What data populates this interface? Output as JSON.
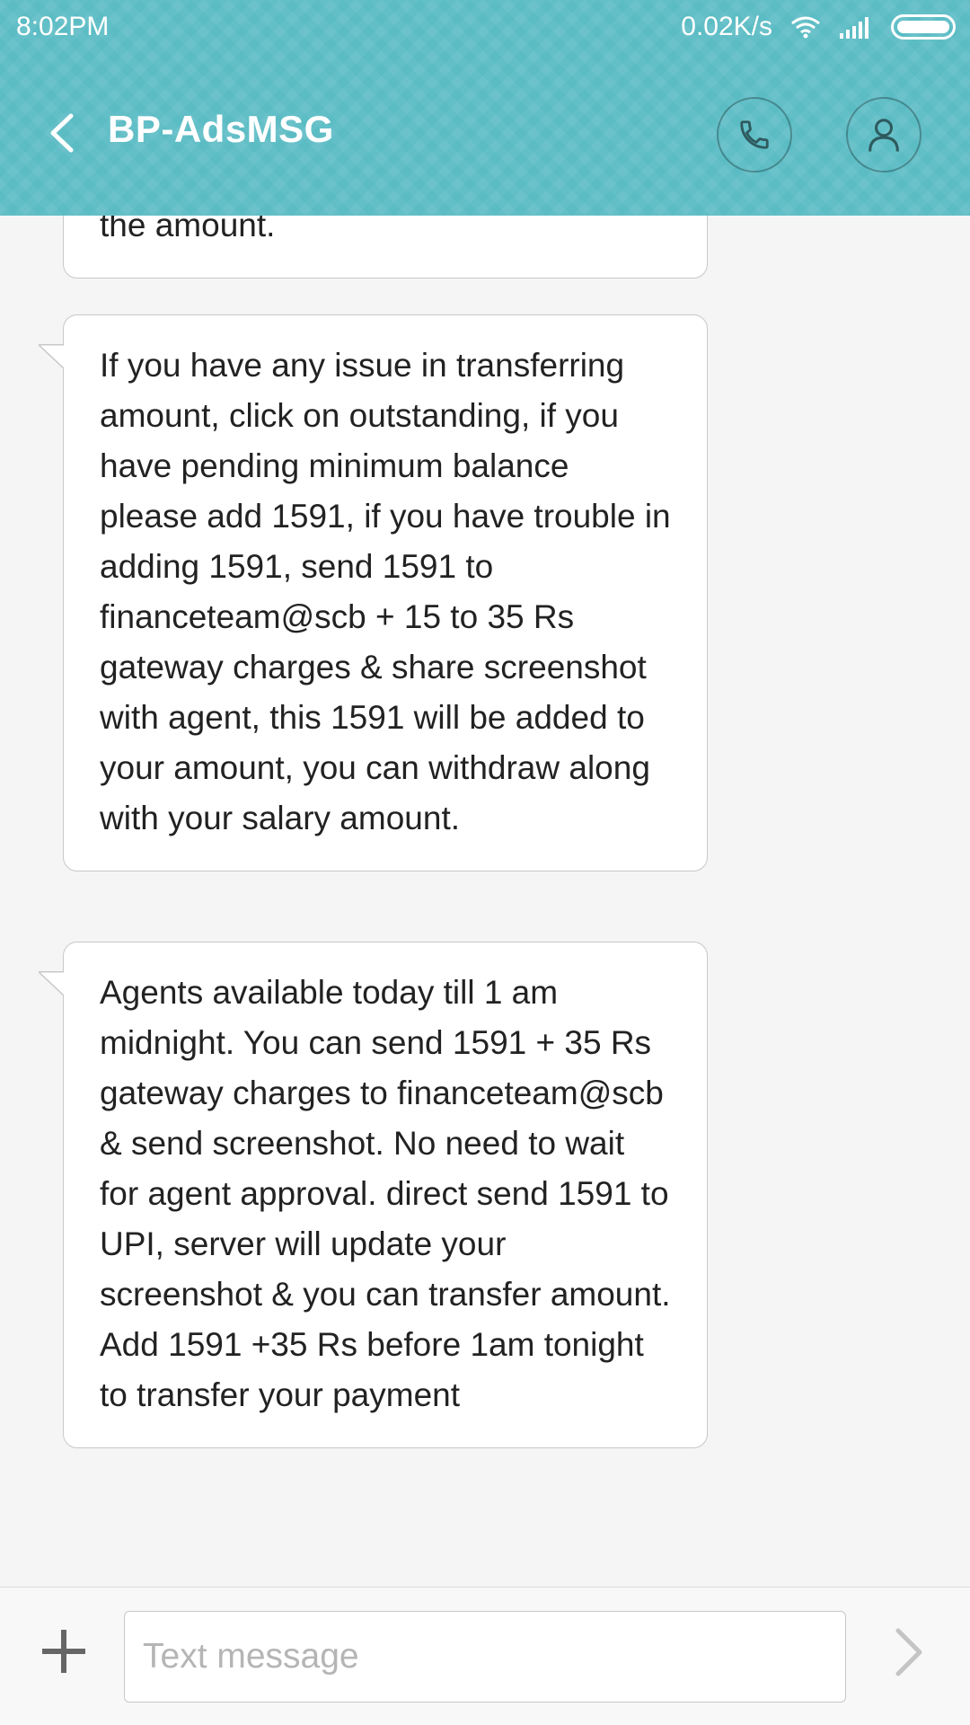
{
  "status_bar": {
    "time": "8:02PM",
    "net_speed": "0.02K/s",
    "wifi_icon": "wifi-icon",
    "signal_icon": "signal-icon",
    "battery_icon": "battery-icon"
  },
  "header": {
    "title": "BP-AdsMSG",
    "back_icon": "chevron-left-icon",
    "call_icon": "phone-icon",
    "contact_icon": "person-icon",
    "background_color": "#5bbcc4"
  },
  "messages": [
    {
      "text": "the amount.",
      "partial": true
    },
    {
      "text": "If you have any issue in transferring amount, click on outstanding, if you have pending minimum balance please add 1591, if you have trouble in adding 1591, send 1591 to financeteam@scb + 15 to 35 Rs gateway charges & share screenshot with agent, this 1591 will be added to your amount, you can withdraw along with your salary amount."
    },
    {
      "text": "Agents available today till 1 am midnight. You can send 1591 + 35 Rs gateway charges to financeteam@scb & send screenshot. No need to wait for agent approval. direct send 1591 to UPI, server will update your screenshot & you can transfer amount. Add 1591 +35 Rs before 1am tonight to transfer your payment"
    }
  ],
  "composer": {
    "placeholder": "Text message",
    "value": "",
    "add_icon": "plus-icon",
    "send_icon": "chevron-right-icon"
  }
}
